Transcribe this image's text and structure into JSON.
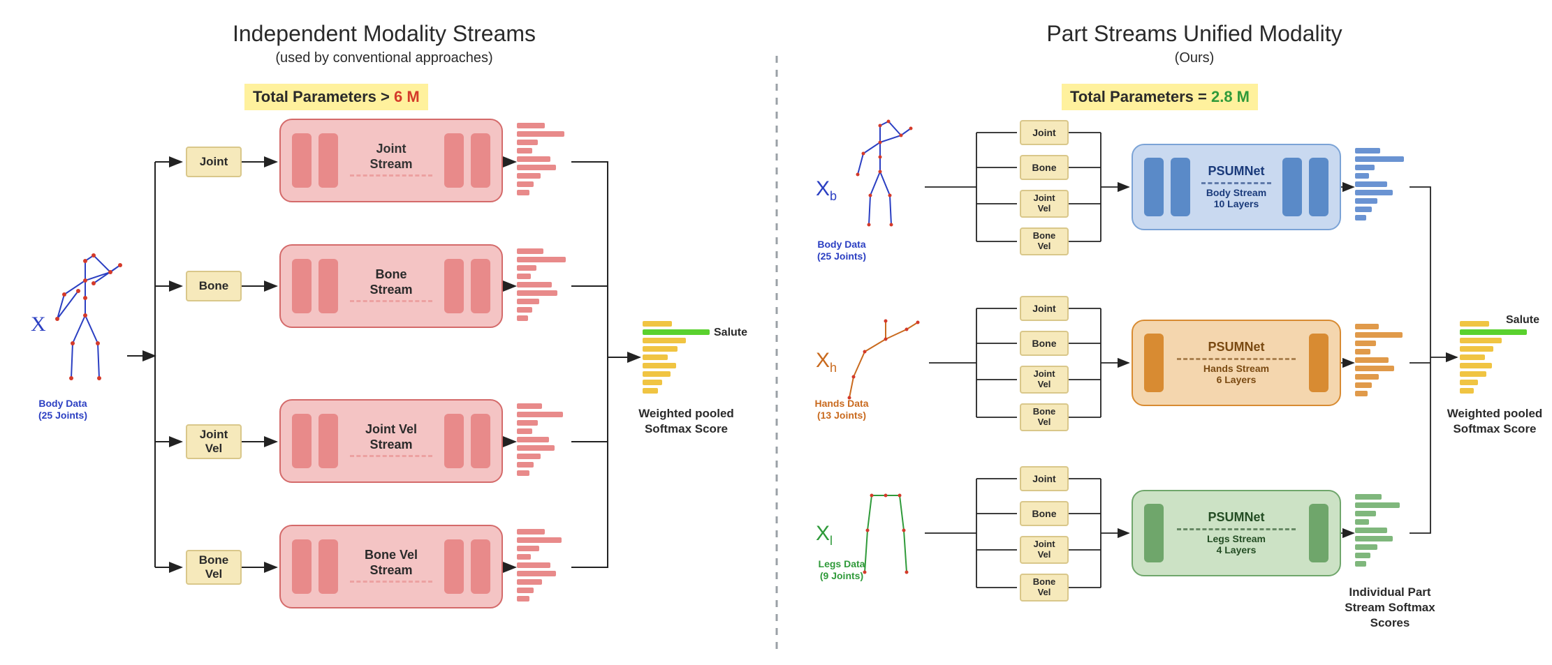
{
  "left": {
    "title": "Independent Modality Streams",
    "subtitle": "(used by conventional approaches)",
    "param_label": "Total Parameters > ",
    "param_value": "6 M",
    "param_color": "#d43a2a",
    "input_symbol": "X",
    "skeleton_label": "Body Data\n(25 Joints)",
    "modalities": [
      "Joint",
      "Bone",
      "Joint\nVel",
      "Bone\nVel"
    ],
    "streams": [
      "Joint\nStream",
      "Bone\nStream",
      "Joint Vel\nStream",
      "Bone Vel\nStream"
    ],
    "output_label": "Weighted pooled\nSoftmax Score",
    "salute": "Salute"
  },
  "right": {
    "title": "Part Streams Unified Modality",
    "subtitle": "(Ours)",
    "param_label": "Total Parameters = ",
    "param_value": "2.8 M",
    "param_color": "#2f9a3a",
    "modality_labels": [
      "Joint",
      "Bone",
      "Joint\nVel",
      "Bone\nVel"
    ],
    "parts": [
      {
        "sym": "X",
        "sub": "b",
        "color": "#2b3fc2",
        "label": "Body Data\n(25 Joints)",
        "net": "PSUMNet",
        "stream": "Body Stream\n10 Layers"
      },
      {
        "sym": "X",
        "sub": "h",
        "color": "#c96a1e",
        "label": "Hands Data\n(13 Joints)",
        "net": "PSUMNet",
        "stream": "Hands Stream\n6 Layers"
      },
      {
        "sym": "X",
        "sub": "l",
        "color": "#2f9a3a",
        "label": "Legs Data\n(9 Joints)",
        "net": "PSUMNet",
        "stream": "Legs Stream\n4 Layers"
      }
    ],
    "part_output": "Individual Part\nStream Softmax\nScores",
    "output_label": "Weighted pooled\nSoftmax Score",
    "salute": "Salute"
  }
}
